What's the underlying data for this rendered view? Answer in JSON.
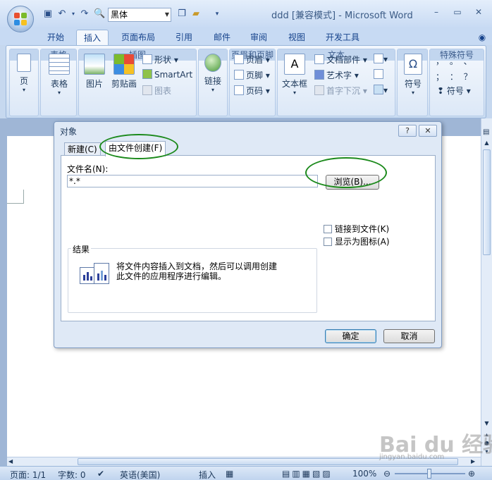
{
  "window": {
    "title": "ddd [兼容模式] - Microsoft Word",
    "controls": [
      "–",
      "▭",
      "✕"
    ]
  },
  "quick_access": {
    "font_name": "黑体",
    "icons": [
      "save-icon",
      "undo-icon",
      "redo-icon",
      "print-preview-icon",
      "copy-icon",
      "folder-icon",
      "customize-arrow-icon"
    ]
  },
  "ribbon_tabs": [
    "开始",
    "插入",
    "页面布局",
    "引用",
    "邮件",
    "审阅",
    "视图",
    "开发工具"
  ],
  "active_tab": "插入",
  "ribbon": {
    "pages": {
      "label": "页",
      "group": ""
    },
    "tables": {
      "label": "表格",
      "group": "表格"
    },
    "illustrations": {
      "picture": "图片",
      "clipart": "剪贴画",
      "shapes": "形状",
      "smartart": "SmartArt",
      "chart": "图表",
      "group": "插图"
    },
    "links": {
      "label": "链接",
      "group": ""
    },
    "header_footer": {
      "header": "页眉",
      "footer": "页脚",
      "page_number": "页码",
      "group": "页眉和页脚"
    },
    "text": {
      "textbox": "文本框",
      "quickparts": "文档部件",
      "wordart": "艺术字",
      "dropcap": "首字下沉",
      "group": "文本"
    },
    "symbols": {
      "label": "符号",
      "group": ""
    },
    "special": {
      "row1": "，  。  、",
      "row2": "；  ：  ？",
      "symbol": "符号",
      "group": "特殊符号"
    }
  },
  "dialog": {
    "title": "对象",
    "help": "?",
    "close": "✕",
    "tabs": [
      "新建(C)",
      "由文件创建(F)"
    ],
    "file_label": "文件名(N):",
    "file_value": "*.*",
    "browse": "浏览(B)...",
    "link_to_file": "链接到文件(K)",
    "show_as_icon": "显示为图标(A)",
    "result_title": "结果",
    "result_text_1": "将文件内容插入到文档，然后可以调用创建",
    "result_text_2": "此文件的应用程序进行编辑。",
    "ok": "确定",
    "cancel": "取消"
  },
  "status": {
    "page": "页面: 1/1",
    "words": "字数: 0",
    "language": "英语(美国)",
    "mode": "插入",
    "zoom": "100%"
  },
  "watermark": {
    "logo": "Bai du 经验",
    "site": "jingyan.baidu.com"
  },
  "colors": {
    "accent": "#15428b",
    "ring": "#1c8a1c",
    "ribbon": "#dbe7f6"
  }
}
